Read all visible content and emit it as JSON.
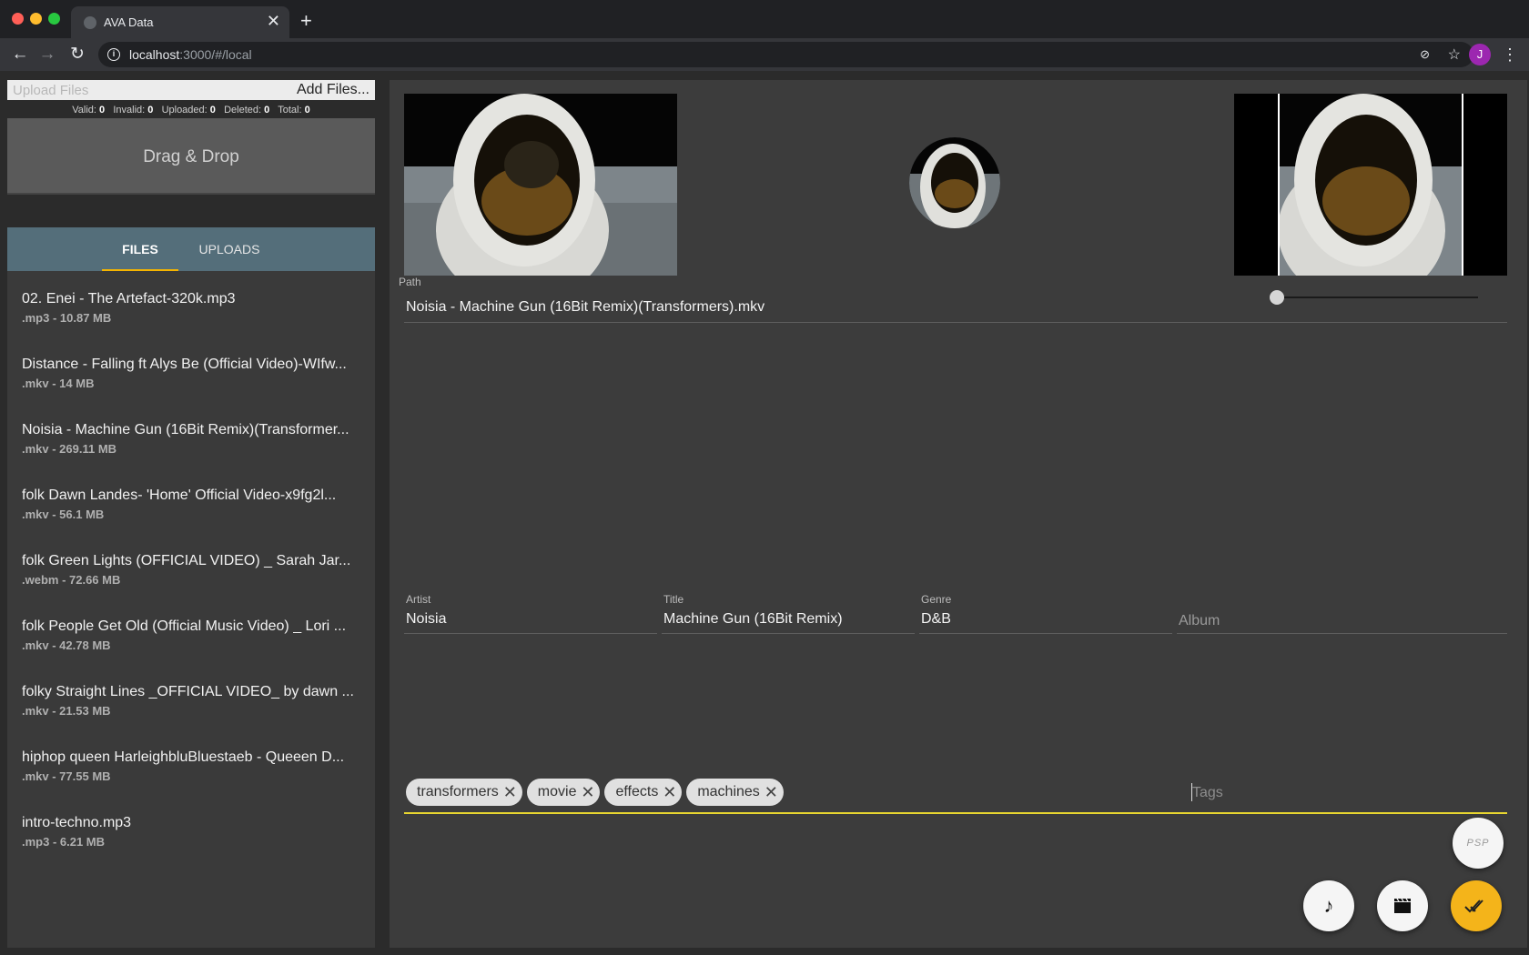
{
  "browser": {
    "tab_title": "AVA Data",
    "tab_close": "✕",
    "new_tab": "+",
    "url_host": "localhost",
    "url_rest": ":3000/#/local",
    "profile_initial": "J"
  },
  "upload": {
    "placeholder": "Upload Files",
    "add_files_label": "Add Files...",
    "stats": {
      "valid_label": "Valid:",
      "valid": "0",
      "invalid_label": "Invalid:",
      "invalid": "0",
      "uploaded_label": "Uploaded:",
      "uploaded": "0",
      "deleted_label": "Deleted:",
      "deleted": "0",
      "total_label": "Total:",
      "total": "0"
    },
    "dropzone_label": "Drag & Drop"
  },
  "tabs": {
    "files": "FILES",
    "uploads": "UPLOADS"
  },
  "files": [
    {
      "name": "02. Enei - The Artefact-320k.mp3",
      "meta": ".mp3 - 10.87 MB"
    },
    {
      "name": "Distance - Falling ft Alys Be (Official Video)-WIfw...",
      "meta": ".mkv - 14 MB"
    },
    {
      "name": "Noisia - Machine Gun (16Bit Remix)(Transformer...",
      "meta": ".mkv - 269.11 MB"
    },
    {
      "name": "folk Dawn Landes- 'Home' Official Video-x9fg2l...",
      "meta": ".mkv - 56.1 MB"
    },
    {
      "name": "folk Green Lights (OFFICIAL VIDEO) _ Sarah Jar...",
      "meta": ".webm - 72.66 MB"
    },
    {
      "name": "folk People Get Old (Official Music Video) _ Lori ...",
      "meta": ".mkv - 42.78 MB"
    },
    {
      "name": "folky Straight Lines _OFFICIAL VIDEO_ by dawn ...",
      "meta": ".mkv - 21.53 MB"
    },
    {
      "name": "hiphop queen HarleighbluBluestaeb - Queeen D...",
      "meta": ".mkv - 77.55 MB"
    },
    {
      "name": "intro-techno.mp3",
      "meta": ".mp3 - 6.21 MB"
    }
  ],
  "editor": {
    "path_label": "Path",
    "path_value": "Noisia - Machine Gun (16Bit Remix)(Transformers).mkv",
    "artist_label": "Artist",
    "artist_value": "Noisia",
    "title_label": "Title",
    "title_value": "Machine Gun (16Bit Remix)",
    "genre_label": "Genre",
    "genre_value": "D&B",
    "album_placeholder": "Album",
    "tags": [
      "transformers",
      "movie",
      "effects",
      "machines"
    ],
    "tag_remove_glyph": "✕",
    "tags_placeholder": "Tags",
    "thumb_slider_fraction": 0.0
  },
  "actions": {
    "psp_label": "PSP",
    "music_glyph": "♪",
    "video_glyph": "🎬",
    "done_glyph": "✔✔"
  },
  "colors": {
    "accent": "#f4b41a",
    "tags_underline": "#e8d630",
    "tabs_bar": "#546e7a",
    "profile": "#9c27b0"
  },
  "icons": [
    "back-arrow-icon",
    "forward-arrow-icon",
    "reload-icon",
    "info-icon",
    "star-icon",
    "kebab-menu-icon",
    "music-note-icon",
    "clapperboard-icon",
    "double-check-icon"
  ]
}
